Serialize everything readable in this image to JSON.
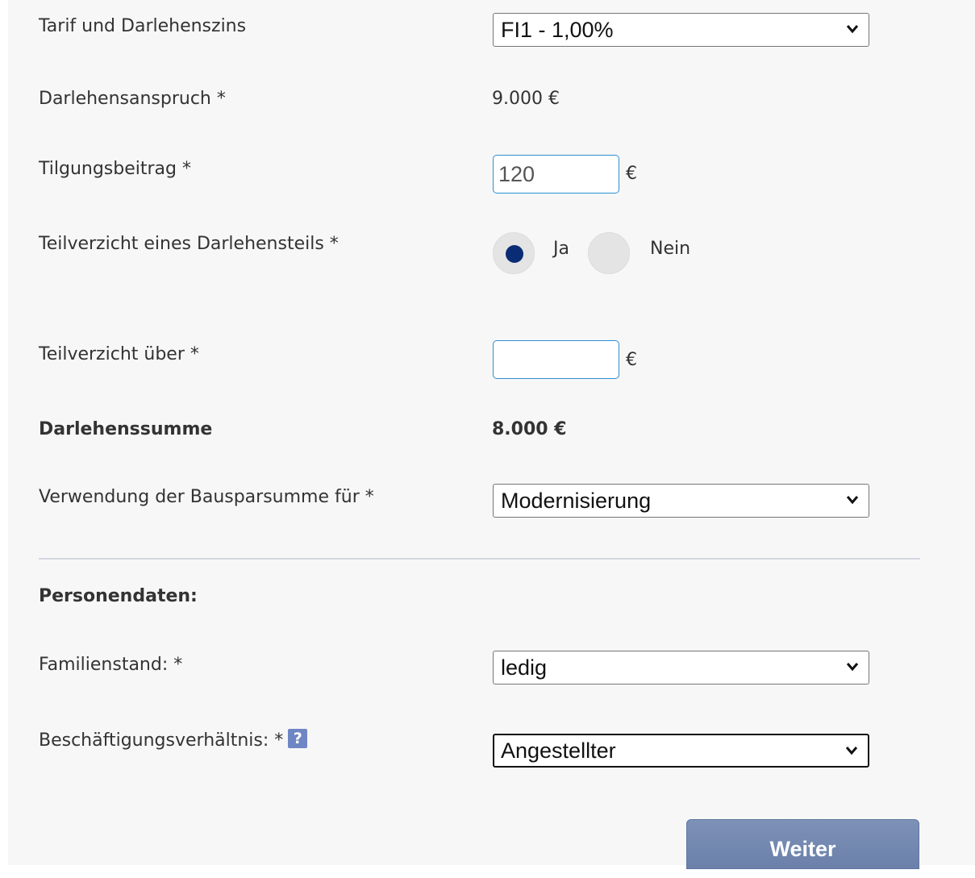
{
  "form": {
    "tarif": {
      "label": "Tarif und Darlehenszins",
      "selected": "FI1 - 1,00%"
    },
    "darlehensanspruch": {
      "label": "Darlehensanspruch *",
      "value": "9.000 €"
    },
    "tilgungsbeitrag": {
      "label": "Tilgungsbeitrag *",
      "value": "120",
      "unit": "€"
    },
    "teilverzicht": {
      "label": "Teilverzicht eines Darlehensteils *",
      "options": [
        {
          "label": "Ja",
          "selected": true
        },
        {
          "label": "Nein",
          "selected": false
        }
      ]
    },
    "teilverzicht_ueber": {
      "label": "Teilverzicht über *",
      "value": "",
      "unit": "€"
    },
    "darlehenssumme": {
      "label": "Darlehenssumme",
      "value": "8.000 €"
    },
    "verwendung": {
      "label": "Verwendung der Bausparsumme für *",
      "selected": "Modernisierung"
    }
  },
  "personendaten": {
    "heading": "Personendaten:",
    "familienstand": {
      "label": "Familienstand: *",
      "selected": "ledig"
    },
    "beschaeftigung": {
      "label": "Beschäftigungsverhältnis: *",
      "help_icon": "help-icon",
      "help_glyph": "?",
      "selected": "Angestellter"
    }
  },
  "actions": {
    "next_label": "Weiter"
  },
  "colors": {
    "panel_background": "#f7f7f7",
    "radio_selected": "#0a2c74",
    "input_border_focus": "#2e8fd1",
    "button": "#7286b0",
    "help_icon": "#6f86c4"
  }
}
